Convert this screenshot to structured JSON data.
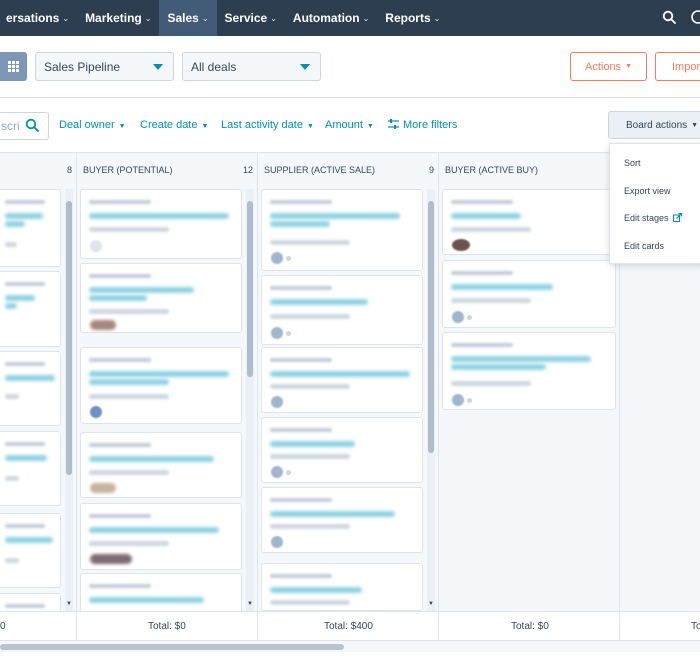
{
  "nav": {
    "items": [
      {
        "label": "ersations"
      },
      {
        "label": "Marketing"
      },
      {
        "label": "Sales"
      },
      {
        "label": "Service"
      },
      {
        "label": "Automation"
      },
      {
        "label": "Reports"
      }
    ]
  },
  "toolbar": {
    "pipeline_select": "Sales Pipeline",
    "deals_select": "All deals",
    "actions_label": "Actions",
    "import_label": "Impor"
  },
  "filters": {
    "search_placeholder": "scri",
    "deal_owner": "Deal owner",
    "create_date": "Create date",
    "last_activity_date": "Last activity date",
    "amount": "Amount",
    "more_filters": "More filters",
    "board_actions": "Board actions"
  },
  "board_menu": {
    "items": [
      "Sort",
      "Export view",
      "Edit stages",
      "Edit cards"
    ]
  },
  "columns": [
    {
      "name": "",
      "count": "8",
      "total": "0"
    },
    {
      "name": "BUYER (POTENTIAL)",
      "count": "12",
      "total": "Total: $0"
    },
    {
      "name": "SUPPLIER (ACTIVE SALE)",
      "count": "9",
      "total": "Total: $400"
    },
    {
      "name": "BUYER (ACTIVE BUY)",
      "count": "",
      "total": "Total: $0"
    },
    {
      "name": "",
      "count": "",
      "total": "To"
    }
  ],
  "colors": {
    "nav_bg": "#2d3e50",
    "nav_active": "#425b76",
    "accent_link": "#0091ae",
    "accent_orange": "#ff7a59",
    "board_bg": "#f5f8fa"
  }
}
